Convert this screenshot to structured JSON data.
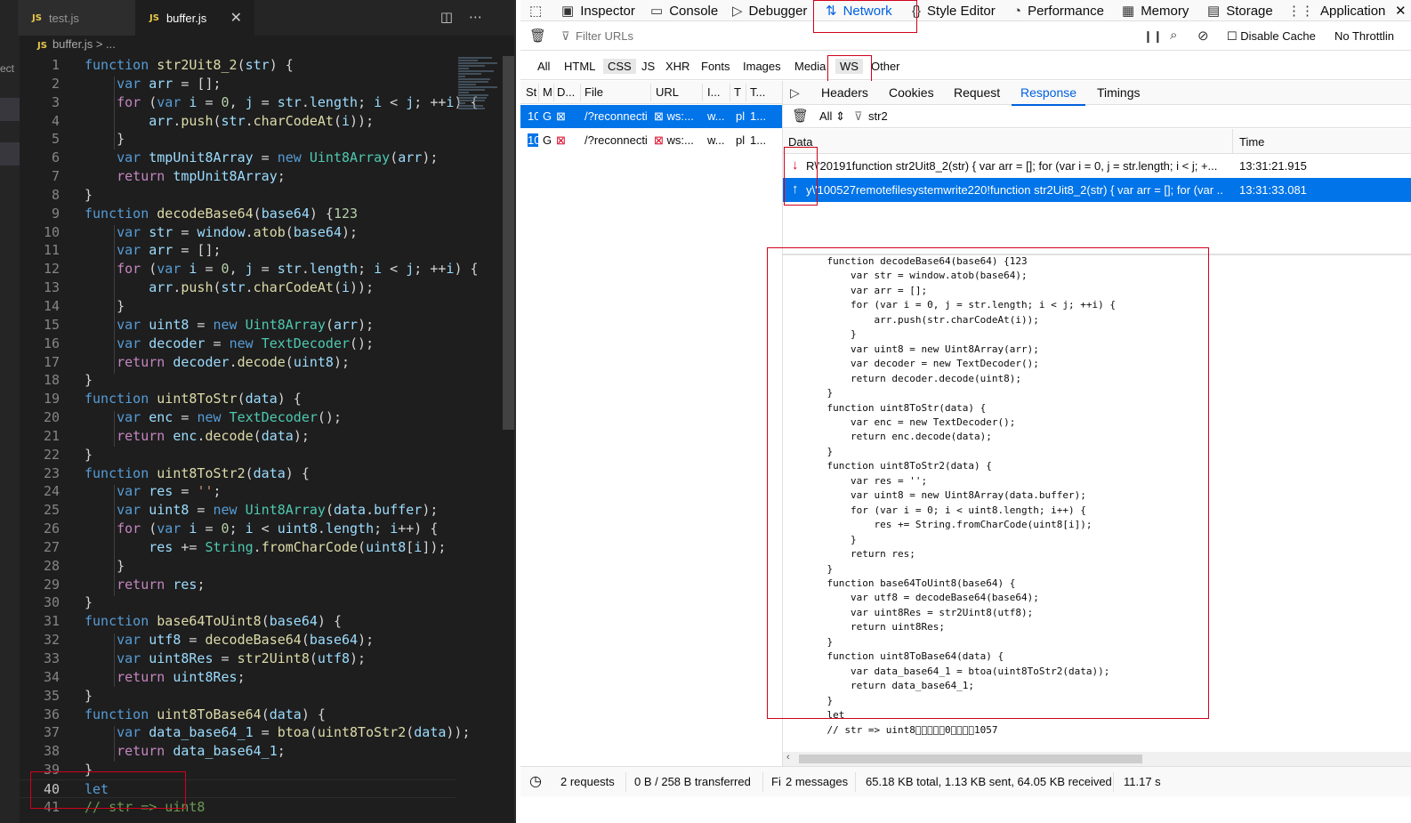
{
  "editor": {
    "tabs": [
      {
        "label": "test.js",
        "badge": "JS"
      },
      {
        "label": "buffer.js",
        "badge": "JS"
      }
    ],
    "close_glyph": "✕",
    "breadcrumb": "buffer.js > ...",
    "left_panel_text": "ect",
    "lines": [
      "1",
      "2",
      "3",
      "4",
      "5",
      "6",
      "7",
      "8",
      "9",
      "10",
      "11",
      "12",
      "13",
      "14",
      "15",
      "16",
      "17",
      "18",
      "19",
      "20",
      "21",
      "22",
      "23",
      "24",
      "25",
      "26",
      "27",
      "28",
      "29",
      "30",
      "31",
      "32",
      "33",
      "34",
      "35",
      "36",
      "37",
      "38",
      "39",
      "40",
      "41"
    ],
    "current_line": "40"
  },
  "devtools": {
    "toolbar": [
      {
        "label": "Inspector",
        "icon": "inspector-icon"
      },
      {
        "label": "Console",
        "icon": "console-icon"
      },
      {
        "label": "Debugger",
        "icon": "debugger-icon"
      },
      {
        "label": "Network",
        "icon": "network-icon"
      },
      {
        "label": "Style Editor",
        "icon": "style-editor-icon"
      },
      {
        "label": "Performance",
        "icon": "performance-icon"
      },
      {
        "label": "Memory",
        "icon": "memory-icon"
      },
      {
        "label": "Storage",
        "icon": "storage-icon"
      },
      {
        "label": "Application",
        "icon": "application-icon"
      }
    ],
    "filter_placeholder": "Filter URLs",
    "disable_cache": "Disable Cache",
    "throttling": "No Throttlin",
    "types": [
      "All",
      "HTML",
      "CSS",
      "JS",
      "XHR",
      "Fonts",
      "Images",
      "Media",
      "WS",
      "Other"
    ],
    "selected_type": "WS",
    "request_columns": [
      "St",
      "M",
      "D...",
      "File",
      "URL",
      "I...",
      "T",
      "T..."
    ],
    "requests": [
      {
        "status": "10",
        "method": "G",
        "file": "/?reconnecti",
        "url": "ws:...",
        "initiator": "w...",
        "type": "pl",
        "transferred": "1..."
      },
      {
        "status": "10",
        "method": "G",
        "file": "/?reconnecti",
        "url": "ws:...",
        "initiator": "w...",
        "type": "pl",
        "transferred": "1..."
      }
    ],
    "detail_tabs": [
      "Headers",
      "Cookies",
      "Request",
      "Response",
      "Timings"
    ],
    "active_detail_tab": "Response",
    "msg_filter_type": "All",
    "msg_filter_text": "str2",
    "msg_columns": {
      "data": "Data",
      "time": "Time"
    },
    "messages": [
      {
        "direction": "↓",
        "data": "R\\'20191function str2Uit8_2(str) { var arr = []; for (var i = 0, j = str.length; i < j; +...",
        "time": "13:31:21.915"
      },
      {
        "direction": "↑",
        "data": "y\\'100527remotefilesystemwrite220!function str2Uit8_2(str) { var arr = []; for (var ...",
        "time": "13:31:33.081"
      }
    ],
    "payload": "    function decodeBase64(base64) {123\n        var str = window.atob(base64);\n        var arr = [];\n        for (var i = 0, j = str.length; i < j; ++i) {\n            arr.push(str.charCodeAt(i));\n        }\n        var uint8 = new Uint8Array(arr);\n        var decoder = new TextDecoder();\n        return decoder.decode(uint8);\n    }\n    function uint8ToStr(data) {\n        var enc = new TextDecoder();\n        return enc.decode(data);\n    }\n    function uint8ToStr2(data) {\n        var res = '';\n        var uint8 = new Uint8Array(data.buffer);\n        for (var i = 0; i < uint8.length; i++) {\n            res += String.fromCharCode(uint8[i]);\n        }\n        return res;\n    }\n    function base64ToUint8(base64) {\n        var utf8 = decodeBase64(base64);\n        var uint8Res = str2Uint8(utf8);\n        return uint8Res;\n    }\n    function uint8ToBase64(data) {\n        var data_base64_1 = btoa(uint8ToStr2(data));\n        return data_base64_1;\n    }\n    let\n    // str => uint8\u0000\u0000\u0000\u0000\u00000\u0000\u0000\u0000\u00001057",
    "status": {
      "requests": "2 requests",
      "transferred": "0 B / 258 B transferred",
      "finish": "Fi",
      "messages": "2 messages",
      "totals": "65.18 KB total, 1.13 KB sent, 64.05 KB received",
      "duration": "11.17 s"
    }
  },
  "colors": {
    "accent": "#0060df",
    "selection": "#0074e8",
    "annotation": "#d0021b"
  }
}
